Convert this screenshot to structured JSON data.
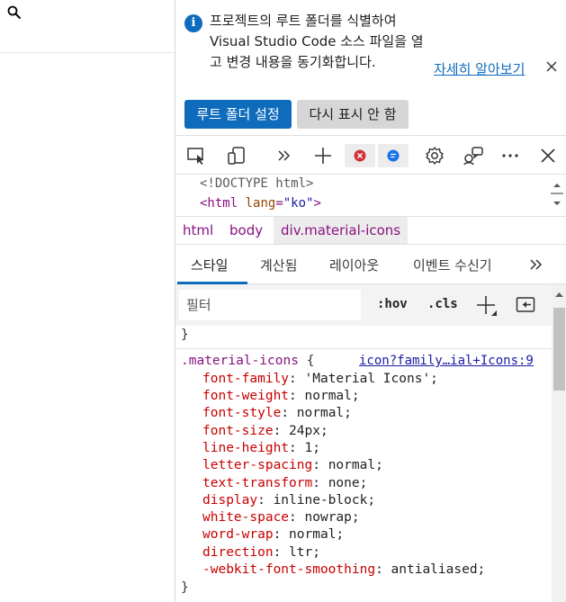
{
  "infobar": {
    "message": "프로젝트의 루트 폴더를 식별하여 Visual Studio Code 소스 파일을 열고 변경 내용을 동기화합니다.",
    "learn_more": "자세히 알아보기",
    "primary_button": "루트 폴더 설정",
    "secondary_button": "다시 표시 안 함"
  },
  "dom": {
    "line1": "<!DOCTYPE html>",
    "line2_tag": "<html",
    "line2_attr": "lang",
    "line2_eq": "=",
    "line2_val": "\"ko\"",
    "line2_close": ">"
  },
  "breadcrumb": [
    "html",
    "body",
    "div.material-icons"
  ],
  "tabs": [
    "스타일",
    "계산됨",
    "레이아웃",
    "이벤트 수신기"
  ],
  "filter": {
    "placeholder": "필터",
    "hov": ":hov",
    "cls": ".cls"
  },
  "styles": {
    "prev_brace": "}",
    "selector": ".material-icons",
    "open_brace": "{",
    "source": "icon?family…ial+Icons:9",
    "close_brace": "}",
    "props": [
      {
        "name": "font-family",
        "value": "'Material Icons';"
      },
      {
        "name": "font-weight",
        "value": "normal;"
      },
      {
        "name": "font-style",
        "value": "normal;"
      },
      {
        "name": "font-size",
        "value": "24px;"
      },
      {
        "name": "line-height",
        "value": "1;"
      },
      {
        "name": "letter-spacing",
        "value": "normal;"
      },
      {
        "name": "text-transform",
        "value": "none;"
      },
      {
        "name": "display",
        "value": "inline-block;"
      },
      {
        "name": "white-space",
        "value": "nowrap;"
      },
      {
        "name": "word-wrap",
        "value": "normal;"
      },
      {
        "name": "direction",
        "value": "ltr;"
      },
      {
        "name": "-webkit-font-smoothing",
        "value": "antialiased;"
      }
    ]
  },
  "colors": {
    "accent": "#0f6cbd",
    "error_badge": "#d13438",
    "issues_badge": "#1a73e8"
  },
  "icons": [
    "search-icon",
    "info-icon",
    "close-icon",
    "inspect-icon",
    "device-emulation-icon",
    "more-tabs-icon",
    "add-tab-icon",
    "error-badge-icon",
    "issues-badge-icon",
    "settings-icon",
    "feedback-icon",
    "more-options-icon",
    "close-devtools-icon",
    "new-rule-icon",
    "toggle-sidebar-icon"
  ]
}
